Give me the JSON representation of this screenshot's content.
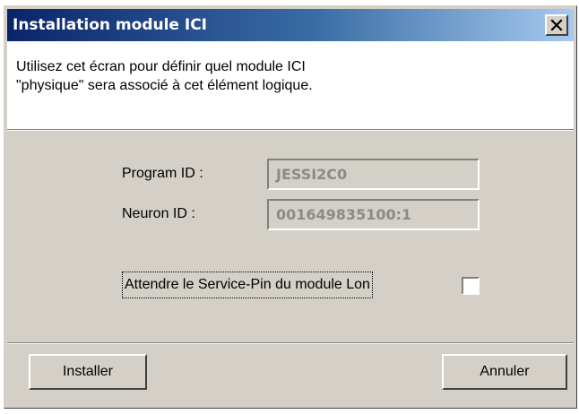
{
  "window": {
    "title": "Installation module ICI",
    "close_icon": "close-x"
  },
  "info": {
    "text": "Utilisez cet écran pour définir quel module ICI\n\"physique\" sera associé à cet élément logique."
  },
  "form": {
    "program_id_label": "Program ID :",
    "program_id_value": "JESSI2C0",
    "neuron_id_label": "Neuron ID :",
    "neuron_id_value": "001649835100:1",
    "service_pin_label": "Attendre le Service-Pin du module Lon",
    "service_pin_checked": false
  },
  "buttons": {
    "install_label": "Installer",
    "cancel_label": "Annuler"
  },
  "colors": {
    "title_gradient_start": "#0a246a",
    "title_gradient_end": "#a6caf0",
    "dialog_face": "#d4d0c8",
    "disabled_text": "#8a8a8a"
  }
}
